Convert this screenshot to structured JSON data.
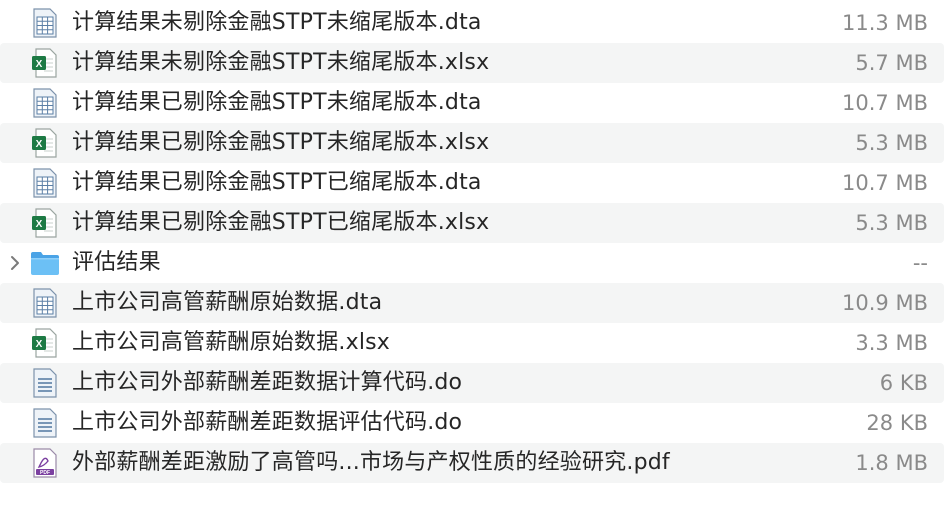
{
  "files": [
    {
      "name": "计算结果未剔除金融STPT未缩尾版本.dta",
      "size": "11.3 MB",
      "icon": "dta-file-icon"
    },
    {
      "name": "计算结果未剔除金融STPT未缩尾版本.xlsx",
      "size": "5.7 MB",
      "icon": "excel-file-icon"
    },
    {
      "name": "计算结果已剔除金融STPT未缩尾版本.dta",
      "size": "10.7 MB",
      "icon": "dta-file-icon"
    },
    {
      "name": "计算结果已剔除金融STPT未缩尾版本.xlsx",
      "size": "5.3 MB",
      "icon": "excel-file-icon"
    },
    {
      "name": "计算结果已剔除金融STPT已缩尾版本.dta",
      "size": "10.7 MB",
      "icon": "dta-file-icon"
    },
    {
      "name": "计算结果已剔除金融STPT已缩尾版本.xlsx",
      "size": "5.3 MB",
      "icon": "excel-file-icon"
    },
    {
      "name": "评估结果",
      "size": "--",
      "icon": "folder-icon"
    },
    {
      "name": "上市公司高管薪酬原始数据.dta",
      "size": "10.9 MB",
      "icon": "dta-file-icon"
    },
    {
      "name": "上市公司高管薪酬原始数据.xlsx",
      "size": "3.3 MB",
      "icon": "excel-file-icon"
    },
    {
      "name": "上市公司外部薪酬差距数据计算代码.do",
      "size": "6 KB",
      "icon": "text-file-icon"
    },
    {
      "name": "上市公司外部薪酬差距数据评估代码.do",
      "size": "28 KB",
      "icon": "text-file-icon"
    },
    {
      "name": "外部薪酬差距激励了高管吗...市场与产权性质的经验研究.pdf",
      "size": "1.8 MB",
      "icon": "pdf-file-icon"
    }
  ],
  "icon_labels": {
    "excel": "X",
    "pdf": "PDF"
  },
  "colors": {
    "row_alt_background": "#f4f5f5",
    "file_name_text": "#262626",
    "size_text": "#8a8a8a",
    "dta_icon": "#5b7fa6",
    "excel_green": "#1d7a44",
    "folder_blue": "#5ab2ee",
    "pdf_purple": "#7b3fa0"
  }
}
